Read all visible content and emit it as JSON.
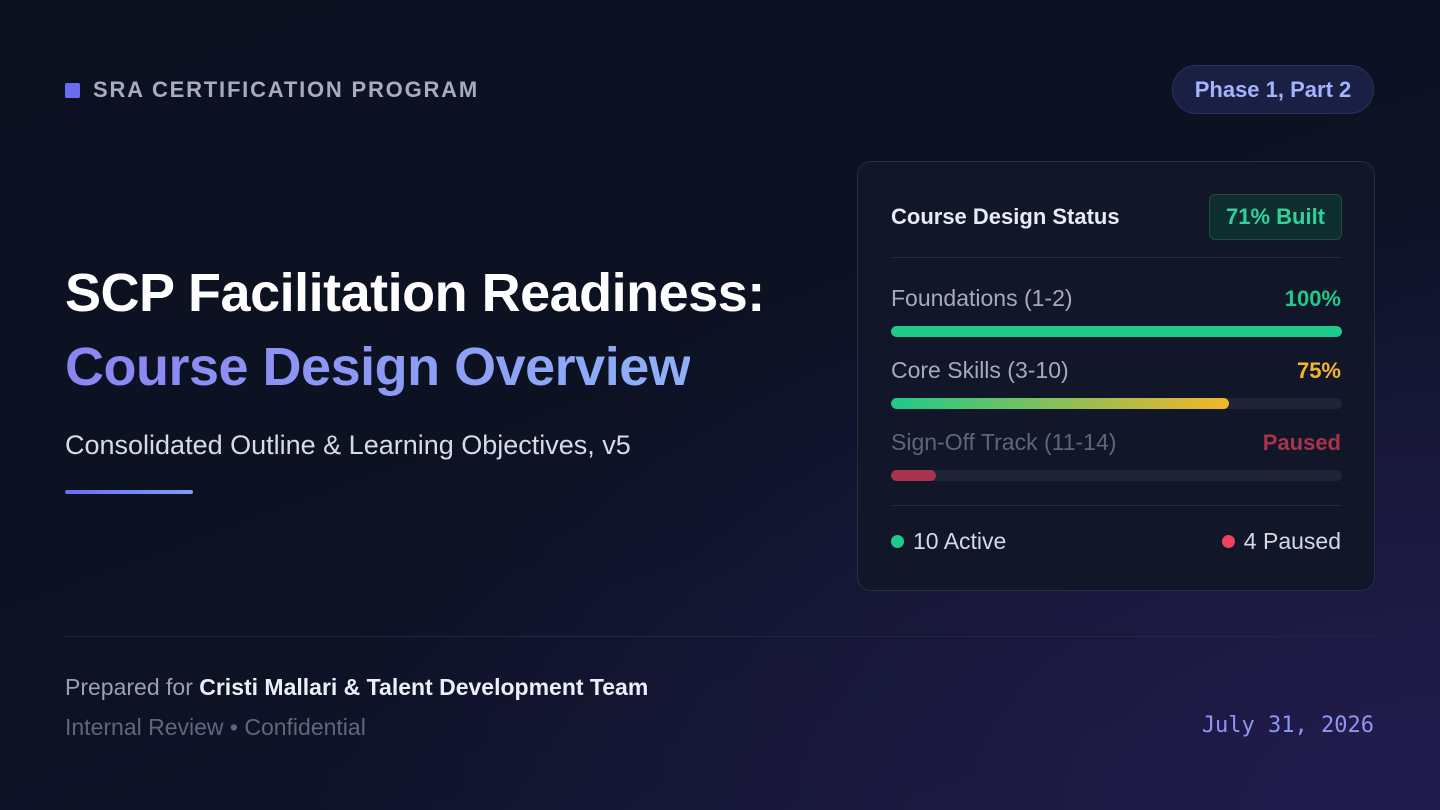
{
  "header": {
    "brand_label": "SRA CERTIFICATION PROGRAM",
    "phase_label": "Phase 1, Part 2"
  },
  "hero": {
    "title_line1": "SCP Facilitation Readiness:",
    "title_line2": "Course Design Overview",
    "subtitle": "Consolidated Outline & Learning Objectives, v5"
  },
  "status_card": {
    "title": "Course Design Status",
    "badge": "71% Built",
    "tracks": [
      {
        "label": "Foundations (1-2)",
        "value_text": "100%",
        "progress": 1.0,
        "color": "#1fc98a",
        "state": "active"
      },
      {
        "label": "Core Skills (3-10)",
        "value_text": "75%",
        "progress": 0.75,
        "color": "#f5b52a",
        "state": "active"
      },
      {
        "label": "Sign-Off Track (11-14)",
        "value_text": "Paused",
        "progress": 0.1,
        "color": "#a8334c",
        "state": "paused"
      }
    ],
    "legend": {
      "active_label": "10 Active",
      "active_color": "#1fc98a",
      "paused_label": "4 Paused",
      "paused_color": "#f0435c"
    }
  },
  "footer": {
    "prepared_prefix": "Prepared for",
    "prepared_for": "Cristi Mallari & Talent Development Team",
    "review_note": "Internal Review • Confidential",
    "date": "July 31, 2026"
  }
}
